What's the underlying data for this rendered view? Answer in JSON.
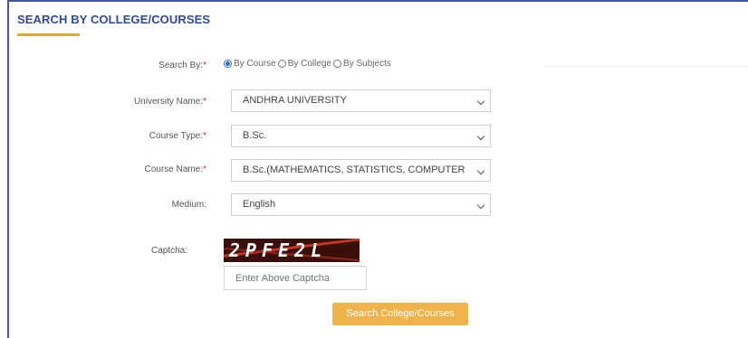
{
  "section": {
    "title": "SEARCH BY COLLEGE/COURSES"
  },
  "search_by": {
    "label": "Search By:",
    "required_mark": "*",
    "options": [
      {
        "label": "By Course",
        "checked": true
      },
      {
        "label": "By College",
        "checked": false
      },
      {
        "label": "By Subjects",
        "checked": false
      }
    ]
  },
  "university": {
    "label": "University Name:",
    "required_mark": "*",
    "value": "ANDHRA UNIVERSITY"
  },
  "course_type": {
    "label": "Course Type:",
    "required_mark": "*",
    "value": "B.Sc."
  },
  "course_name": {
    "label": "Course Name:",
    "required_mark": "*",
    "value": "B.Sc.(MATHEMATICS, STATISTICS, COMPUTER"
  },
  "medium": {
    "label": "Medium:",
    "value": "English"
  },
  "captcha": {
    "label": "Captcha:",
    "image_text": "2PFE2L",
    "placeholder": "Enter Above Captcha"
  },
  "submit": {
    "label": "Search College/Courses"
  },
  "colors": {
    "title": "#2d4a9a",
    "accent": "#e9a92f",
    "button": "#f0b24a",
    "required": "#d9232d"
  }
}
